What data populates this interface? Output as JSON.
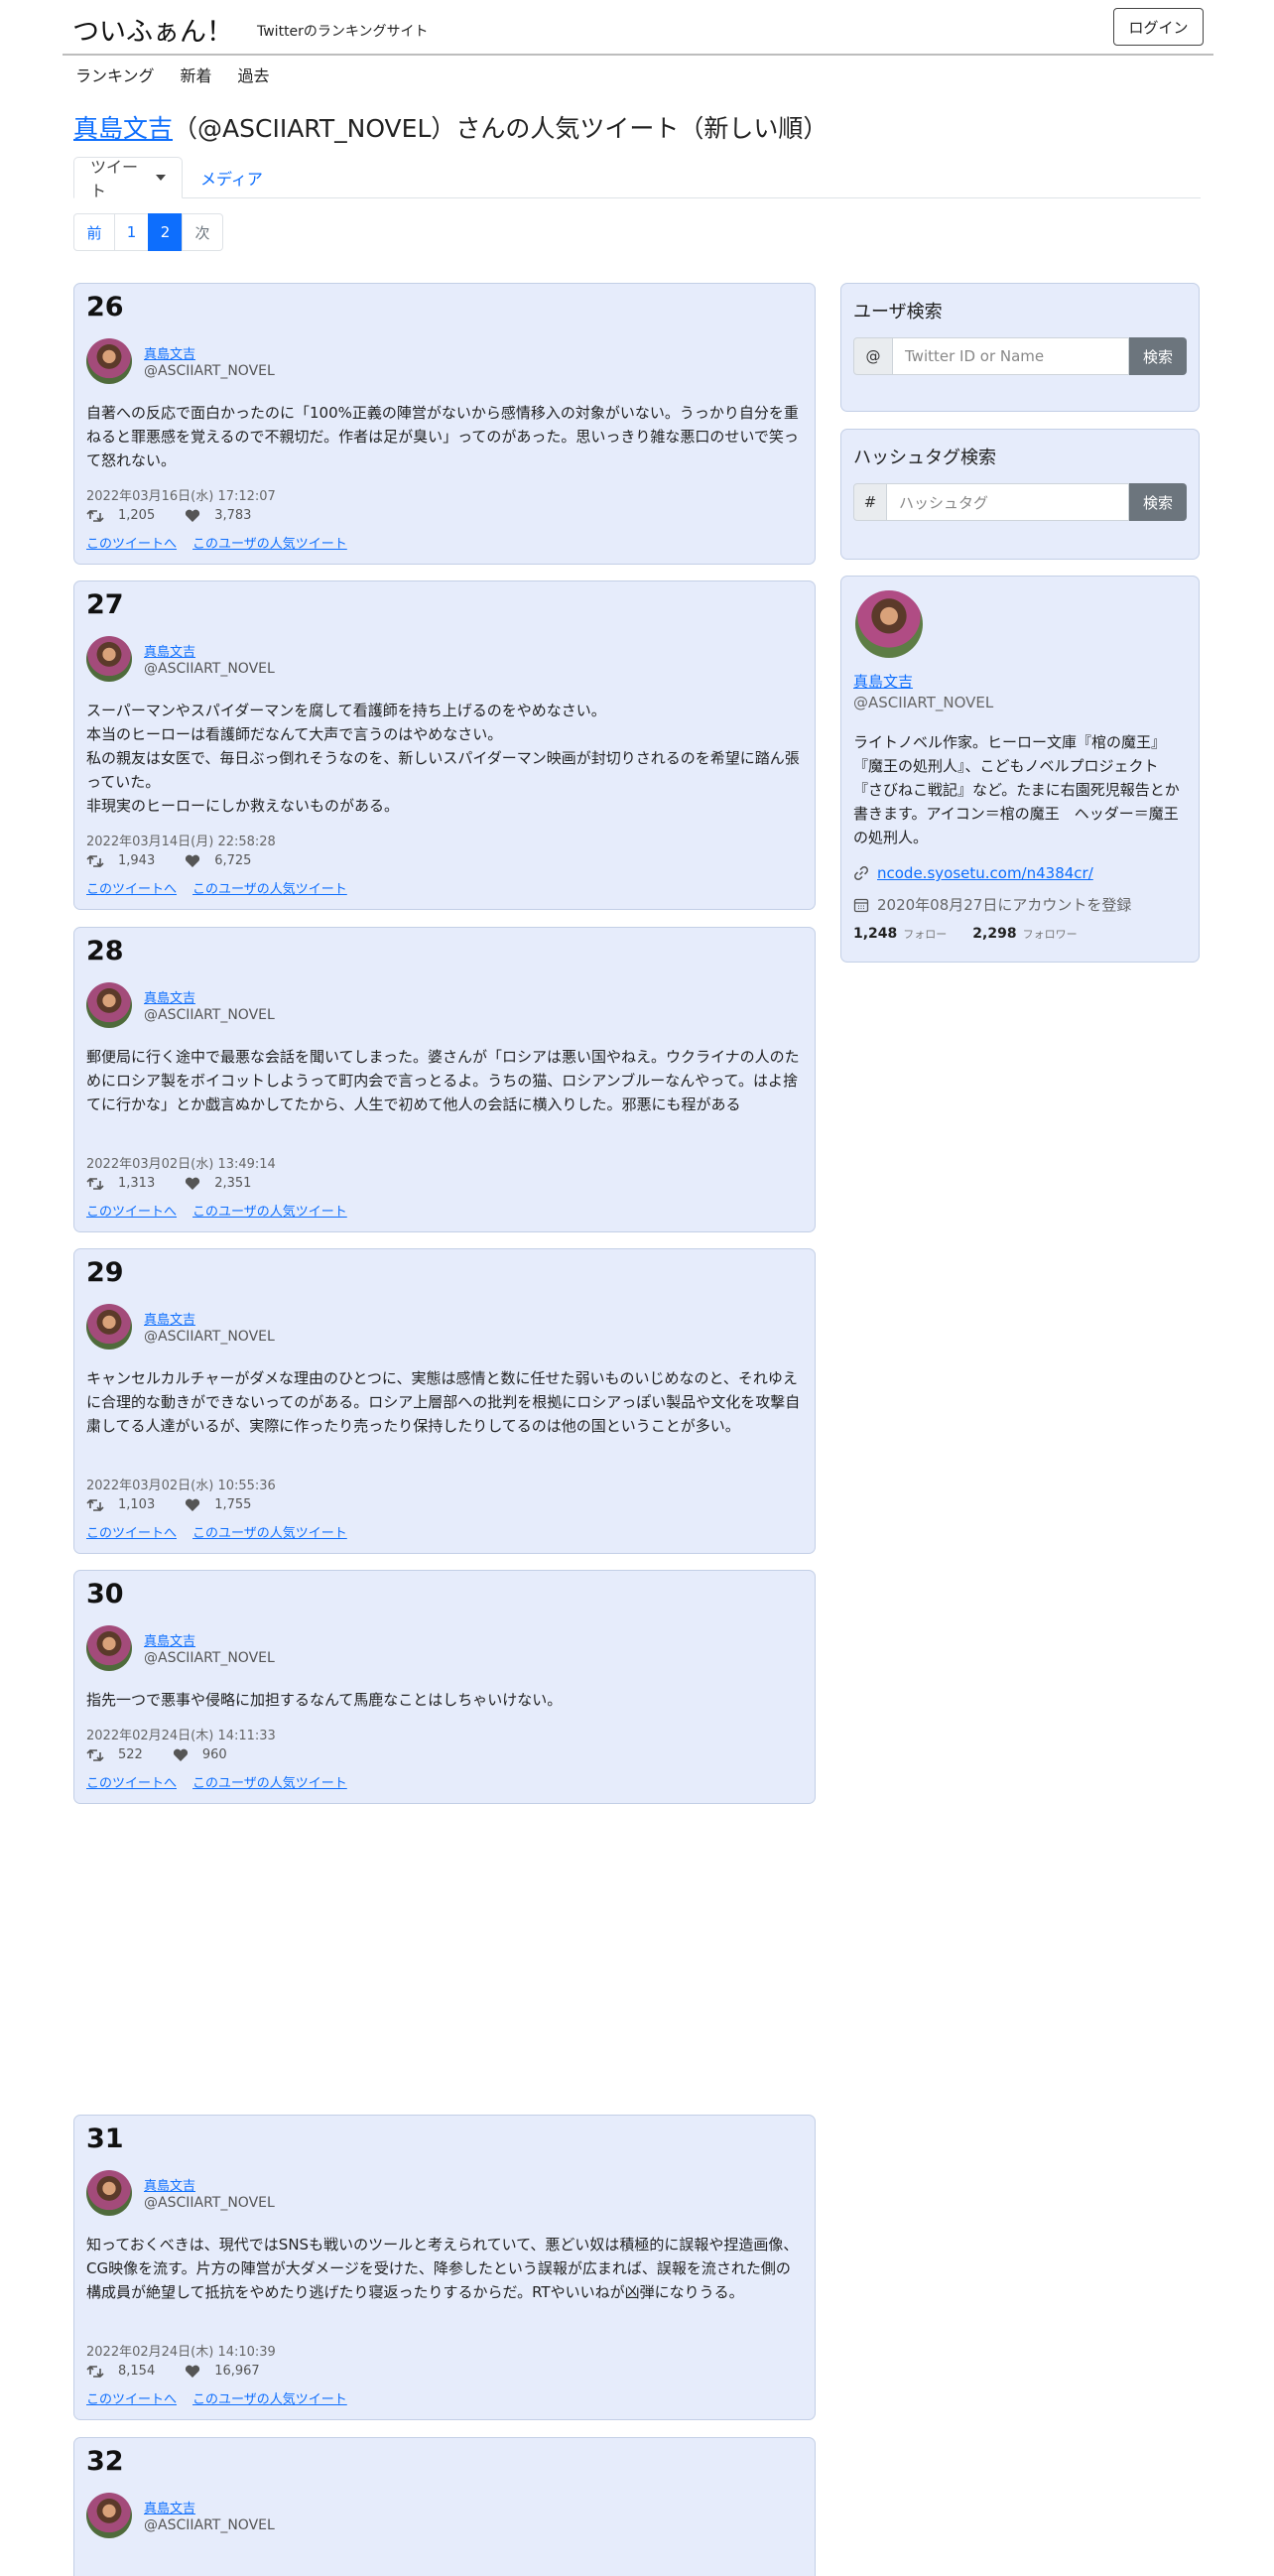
{
  "header": {
    "brand": "ついふぁん！",
    "tagline": "Twitterのランキングサイト",
    "login_label": "ログイン"
  },
  "nav": [
    "ランキング",
    "新着",
    "過去"
  ],
  "page_title": {
    "user_link": "真島文吉",
    "rest": "（@ASCIIART_NOVEL）さんの人気ツイート（新しい順）"
  },
  "tabs": {
    "tweets": "ツイート",
    "media": "メディア"
  },
  "pagination": {
    "prev": "前",
    "pages": [
      "1",
      "2"
    ],
    "current": "2",
    "next": "次"
  },
  "tweets": [
    {
      "rank": "26",
      "name": "真島文吉",
      "handle": "@ASCIIART_NOVEL",
      "text": "自著への反応で面白かったのに「100%正義の陣営がないから感情移入の対象がいない。うっかり自分を重ねると罪悪感を覚えるので不親切だ。作者は足が臭い」ってのがあった。思いっきり雑な悪口のせいで笑って怒れない。",
      "date": "2022年03月16日(水) 17:12:07",
      "retweets": "1,205",
      "likes": "3,783",
      "link_tweet": "このツイートへ",
      "link_user": "このユーザの人気ツイート"
    },
    {
      "rank": "27",
      "name": "真島文吉",
      "handle": "@ASCIIART_NOVEL",
      "text": "スーパーマンやスパイダーマンを腐して看護師を持ち上げるのをやめなさい。\n本当のヒーローは看護師だなんて大声で言うのはやめなさい。\n私の親友は女医で、毎日ぶっ倒れそうなのを、新しいスパイダーマン映画が封切りされるのを希望に踏ん張っていた。\n非現実のヒーローにしか救えないものがある。",
      "date": "2022年03月14日(月) 22:58:28",
      "retweets": "1,943",
      "likes": "6,725",
      "link_tweet": "このツイートへ",
      "link_user": "このユーザの人気ツイート"
    },
    {
      "rank": "28",
      "name": "真島文吉",
      "handle": "@ASCIIART_NOVEL",
      "text": "郵便局に行く途中で最悪な会話を聞いてしまった。婆さんが「ロシアは悪い国やねえ。ウクライナの人のためにロシア製をボイコットしようって町内会で言っとるよ。うちの猫、ロシアンブルーなんやって。はよ捨てに行かな」とか戯言ぬかしてたから、人生で初めて他人の会話に横入りした。邪悪にも程がある",
      "date": "2022年03月02日(水) 13:49:14",
      "retweets": "1,313",
      "likes": "2,351",
      "link_tweet": "このツイートへ",
      "link_user": "このユーザの人気ツイート"
    },
    {
      "rank": "29",
      "name": "真島文吉",
      "handle": "@ASCIIART_NOVEL",
      "text": "キャンセルカルチャーがダメな理由のひとつに、実態は感情と数に任せた弱いものいじめなのと、それゆえに合理的な動きができないってのがある。ロシア上層部への批判を根拠にロシアっぽい製品や文化を攻撃自粛してる人達がいるが、実際に作ったり売ったり保持したりしてるのは他の国ということが多い。",
      "date": "2022年03月02日(水) 10:55:36",
      "retweets": "1,103",
      "likes": "1,755",
      "link_tweet": "このツイートへ",
      "link_user": "このユーザの人気ツイート"
    },
    {
      "rank": "30",
      "name": "真島文吉",
      "handle": "@ASCIIART_NOVEL",
      "text": "指先一つで悪事や侵略に加担するなんて馬鹿なことはしちゃいけない。",
      "date": "2022年02月24日(木) 14:11:33",
      "retweets": "522",
      "likes": "960",
      "link_tweet": "このツイートへ",
      "link_user": "このユーザの人気ツイート"
    },
    {
      "rank": "31",
      "name": "真島文吉",
      "handle": "@ASCIIART_NOVEL",
      "text": "知っておくべきは、現代ではSNSも戦いのツールと考えられていて、悪どい奴は積極的に誤報や捏造画像、CG映像を流す。片方の陣営が大ダメージを受けた、降参したという誤報が広まれば、誤報を流された側の構成員が絶望して抵抗をやめたり逃げたり寝返ったりするからだ。RTやいいねが凶弾になりうる。",
      "date": "2022年02月24日(木) 14:10:39",
      "retweets": "8,154",
      "likes": "16,967",
      "link_tweet": "このツイートへ",
      "link_user": "このユーザの人気ツイート"
    },
    {
      "rank": "32",
      "name": "真島文吉",
      "handle": "@ASCIIART_NOVEL",
      "text": "",
      "date": "",
      "retweets": "",
      "likes": "",
      "link_tweet": "",
      "link_user": ""
    }
  ],
  "sidebar": {
    "user_search": {
      "title": "ユーザ検索",
      "prefix": "@",
      "placeholder": "Twitter ID or Name",
      "button": "検索"
    },
    "hashtag_search": {
      "title": "ハッシュタグ検索",
      "prefix": "#",
      "placeholder": "ハッシュタグ",
      "button": "検索"
    },
    "profile": {
      "name": "真島文吉",
      "handle": "@ASCIIART_NOVEL",
      "bio": "ライトノベル作家。ヒーロー文庫『棺の魔王』『魔王の処刑人』、こどもノベルプロジェクト『さびねこ戦記』など。たまに右園死児報告とか書きます。アイコン＝棺の魔王　ヘッダー＝魔王の処刑人。",
      "link": "ncode.syosetu.com/n4384cr/",
      "joined": "2020年08月27日にアカウントを登録",
      "following": "1,248",
      "following_label": "フォロー",
      "followers": "2,298",
      "followers_label": "フォロワー"
    }
  },
  "colors": {
    "card_bg": "#e6ecfb",
    "link": "#0d6efd",
    "button_gray": "#6c757d"
  }
}
